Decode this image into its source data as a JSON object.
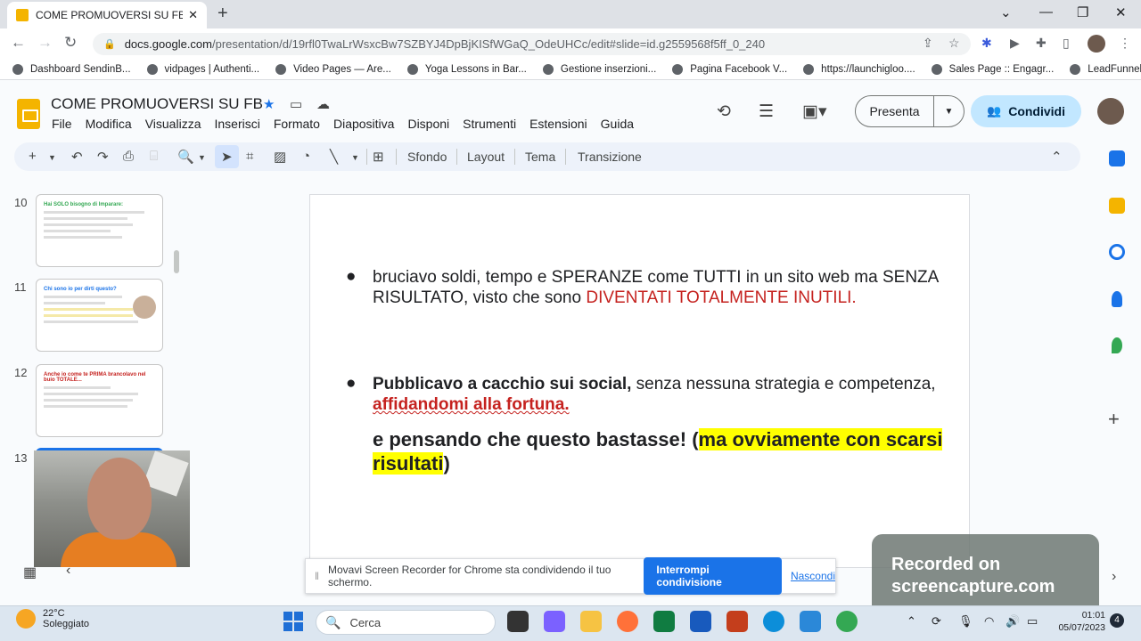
{
  "browser": {
    "tab_title": "COME PROMUOVERSI SU FB - Pr",
    "url_host": "docs.google.com",
    "url_path": "/presentation/d/19rfl0TwaLrWsxcBw7SZBYJ4DpBjKISfWGaQ_OdeUHCc/edit#slide=id.g2559568f5ff_0_240",
    "bookmarks": [
      "Dashboard SendinB...",
      "vidpages | Authenti...",
      "Video Pages — Are...",
      "Yoga Lessons in Bar...",
      "Gestione inserzioni...",
      "Pagina Facebook V...",
      "https://launchigloo....",
      "Sales Page :: Engagr...",
      "LeadFunnel"
    ]
  },
  "doc": {
    "title": "COME PROMUOVERSI SU FB",
    "menu": [
      "File",
      "Modifica",
      "Visualizza",
      "Inserisci",
      "Formato",
      "Diapositiva",
      "Disponi",
      "Strumenti",
      "Estensioni",
      "Guida"
    ],
    "present_label": "Presenta",
    "share_label": "Condividi"
  },
  "toolbar": {
    "background": "Sfondo",
    "layout": "Layout",
    "theme": "Tema",
    "transition": "Transizione"
  },
  "filmstrip": {
    "slides": [
      {
        "num": "10",
        "title": "Hai SOLO bisogno di Imparare:"
      },
      {
        "num": "11",
        "title": "Chi sono io per dirti questo?"
      },
      {
        "num": "12",
        "title": "Anche io come te PRIMA brancolavo nel buio TOTALE..."
      },
      {
        "num": "13",
        "title": ""
      }
    ]
  },
  "slide": {
    "p1_a": "bruciavo soldi, tempo e SPERANZE come TUTTI in un sito web ma SENZA RISULTATO, visto che sono ",
    "p1_b": "DIVENTATI TOTALMENTE INUTILI.",
    "p2_a": "Pubblicavo a cacchio sui social,",
    "p2_b": " senza nessuna strategia e competenza, ",
    "p2_c": "affidandomi alla fortuna.",
    "p3_a": "e pensando che questo bastasse! (",
    "p3_b": "ma ovviamente con scarsi risultati",
    "p3_c": ")"
  },
  "share_bar": {
    "message": "Movavi Screen Recorder for Chrome sta condividendo il tuo schermo.",
    "stop": "Interrompi condivisione",
    "hide": "Nascondi"
  },
  "watermark": {
    "line1": "Recorded on",
    "line2": "screencapture.com"
  },
  "taskbar": {
    "temp": "22°C",
    "weather": "Soleggiato",
    "search": "Cerca",
    "time": "01:01",
    "date": "05/07/2023",
    "notifications": "4"
  },
  "colors": {
    "accent_blue": "#1a73e8",
    "share_button": "#c2e7ff",
    "slides_yellow": "#f4b400",
    "highlight": "#ffff00",
    "emphasis_red": "#c5221f"
  }
}
